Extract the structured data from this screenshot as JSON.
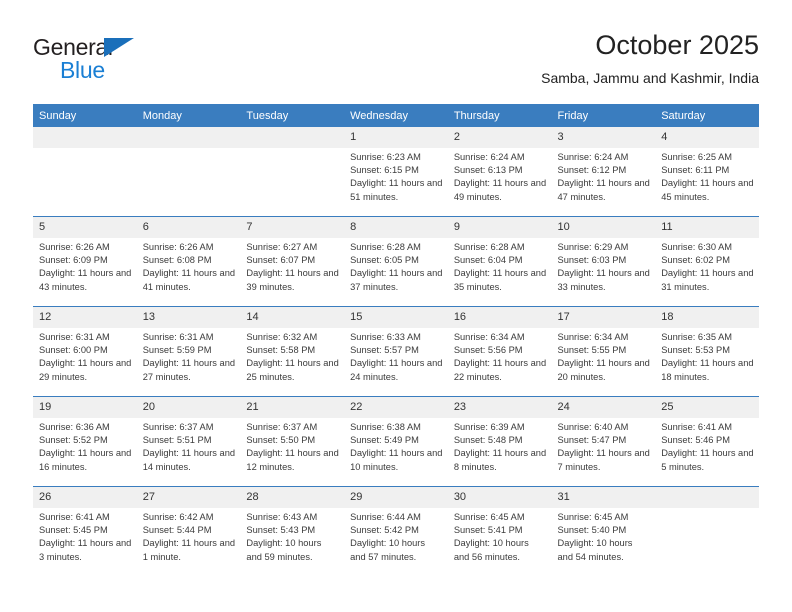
{
  "brand": {
    "name_part1": "General",
    "name_part2": "Blue",
    "triangle_color": "#1a6fba",
    "blue_color": "#1a7fd4"
  },
  "header": {
    "title": "October 2025",
    "subtitle": "Samba, Jammu and Kashmir, India"
  },
  "theme": {
    "header_bg": "#3a7dbf",
    "daynum_bg": "#f0f0f0",
    "text": "#3b3b3b"
  },
  "calendar": {
    "weekday_headers": [
      "Sunday",
      "Monday",
      "Tuesday",
      "Wednesday",
      "Thursday",
      "Friday",
      "Saturday"
    ],
    "labels": {
      "sunrise": "Sunrise:",
      "sunset": "Sunset:",
      "daylight": "Daylight:"
    },
    "weeks": [
      [
        {
          "day": "",
          "empty": true
        },
        {
          "day": "",
          "empty": true
        },
        {
          "day": "",
          "empty": true
        },
        {
          "day": "1",
          "sunrise": "Sunrise: 6:23 AM",
          "sunset": "Sunset: 6:15 PM",
          "daylight": "Daylight: 11 hours and 51 minutes."
        },
        {
          "day": "2",
          "sunrise": "Sunrise: 6:24 AM",
          "sunset": "Sunset: 6:13 PM",
          "daylight": "Daylight: 11 hours and 49 minutes."
        },
        {
          "day": "3",
          "sunrise": "Sunrise: 6:24 AM",
          "sunset": "Sunset: 6:12 PM",
          "daylight": "Daylight: 11 hours and 47 minutes."
        },
        {
          "day": "4",
          "sunrise": "Sunrise: 6:25 AM",
          "sunset": "Sunset: 6:11 PM",
          "daylight": "Daylight: 11 hours and 45 minutes."
        }
      ],
      [
        {
          "day": "5",
          "sunrise": "Sunrise: 6:26 AM",
          "sunset": "Sunset: 6:09 PM",
          "daylight": "Daylight: 11 hours and 43 minutes."
        },
        {
          "day": "6",
          "sunrise": "Sunrise: 6:26 AM",
          "sunset": "Sunset: 6:08 PM",
          "daylight": "Daylight: 11 hours and 41 minutes."
        },
        {
          "day": "7",
          "sunrise": "Sunrise: 6:27 AM",
          "sunset": "Sunset: 6:07 PM",
          "daylight": "Daylight: 11 hours and 39 minutes."
        },
        {
          "day": "8",
          "sunrise": "Sunrise: 6:28 AM",
          "sunset": "Sunset: 6:05 PM",
          "daylight": "Daylight: 11 hours and 37 minutes."
        },
        {
          "day": "9",
          "sunrise": "Sunrise: 6:28 AM",
          "sunset": "Sunset: 6:04 PM",
          "daylight": "Daylight: 11 hours and 35 minutes."
        },
        {
          "day": "10",
          "sunrise": "Sunrise: 6:29 AM",
          "sunset": "Sunset: 6:03 PM",
          "daylight": "Daylight: 11 hours and 33 minutes."
        },
        {
          "day": "11",
          "sunrise": "Sunrise: 6:30 AM",
          "sunset": "Sunset: 6:02 PM",
          "daylight": "Daylight: 11 hours and 31 minutes."
        }
      ],
      [
        {
          "day": "12",
          "sunrise": "Sunrise: 6:31 AM",
          "sunset": "Sunset: 6:00 PM",
          "daylight": "Daylight: 11 hours and 29 minutes."
        },
        {
          "day": "13",
          "sunrise": "Sunrise: 6:31 AM",
          "sunset": "Sunset: 5:59 PM",
          "daylight": "Daylight: 11 hours and 27 minutes."
        },
        {
          "day": "14",
          "sunrise": "Sunrise: 6:32 AM",
          "sunset": "Sunset: 5:58 PM",
          "daylight": "Daylight: 11 hours and 25 minutes."
        },
        {
          "day": "15",
          "sunrise": "Sunrise: 6:33 AM",
          "sunset": "Sunset: 5:57 PM",
          "daylight": "Daylight: 11 hours and 24 minutes."
        },
        {
          "day": "16",
          "sunrise": "Sunrise: 6:34 AM",
          "sunset": "Sunset: 5:56 PM",
          "daylight": "Daylight: 11 hours and 22 minutes."
        },
        {
          "day": "17",
          "sunrise": "Sunrise: 6:34 AM",
          "sunset": "Sunset: 5:55 PM",
          "daylight": "Daylight: 11 hours and 20 minutes."
        },
        {
          "day": "18",
          "sunrise": "Sunrise: 6:35 AM",
          "sunset": "Sunset: 5:53 PM",
          "daylight": "Daylight: 11 hours and 18 minutes."
        }
      ],
      [
        {
          "day": "19",
          "sunrise": "Sunrise: 6:36 AM",
          "sunset": "Sunset: 5:52 PM",
          "daylight": "Daylight: 11 hours and 16 minutes."
        },
        {
          "day": "20",
          "sunrise": "Sunrise: 6:37 AM",
          "sunset": "Sunset: 5:51 PM",
          "daylight": "Daylight: 11 hours and 14 minutes."
        },
        {
          "day": "21",
          "sunrise": "Sunrise: 6:37 AM",
          "sunset": "Sunset: 5:50 PM",
          "daylight": "Daylight: 11 hours and 12 minutes."
        },
        {
          "day": "22",
          "sunrise": "Sunrise: 6:38 AM",
          "sunset": "Sunset: 5:49 PM",
          "daylight": "Daylight: 11 hours and 10 minutes."
        },
        {
          "day": "23",
          "sunrise": "Sunrise: 6:39 AM",
          "sunset": "Sunset: 5:48 PM",
          "daylight": "Daylight: 11 hours and 8 minutes."
        },
        {
          "day": "24",
          "sunrise": "Sunrise: 6:40 AM",
          "sunset": "Sunset: 5:47 PM",
          "daylight": "Daylight: 11 hours and 7 minutes."
        },
        {
          "day": "25",
          "sunrise": "Sunrise: 6:41 AM",
          "sunset": "Sunset: 5:46 PM",
          "daylight": "Daylight: 11 hours and 5 minutes."
        }
      ],
      [
        {
          "day": "26",
          "sunrise": "Sunrise: 6:41 AM",
          "sunset": "Sunset: 5:45 PM",
          "daylight": "Daylight: 11 hours and 3 minutes."
        },
        {
          "day": "27",
          "sunrise": "Sunrise: 6:42 AM",
          "sunset": "Sunset: 5:44 PM",
          "daylight": "Daylight: 11 hours and 1 minute."
        },
        {
          "day": "28",
          "sunrise": "Sunrise: 6:43 AM",
          "sunset": "Sunset: 5:43 PM",
          "daylight": "Daylight: 10 hours and 59 minutes."
        },
        {
          "day": "29",
          "sunrise": "Sunrise: 6:44 AM",
          "sunset": "Sunset: 5:42 PM",
          "daylight": "Daylight: 10 hours and 57 minutes."
        },
        {
          "day": "30",
          "sunrise": "Sunrise: 6:45 AM",
          "sunset": "Sunset: 5:41 PM",
          "daylight": "Daylight: 10 hours and 56 minutes."
        },
        {
          "day": "31",
          "sunrise": "Sunrise: 6:45 AM",
          "sunset": "Sunset: 5:40 PM",
          "daylight": "Daylight: 10 hours and 54 minutes."
        },
        {
          "day": "",
          "empty": true
        }
      ]
    ]
  }
}
